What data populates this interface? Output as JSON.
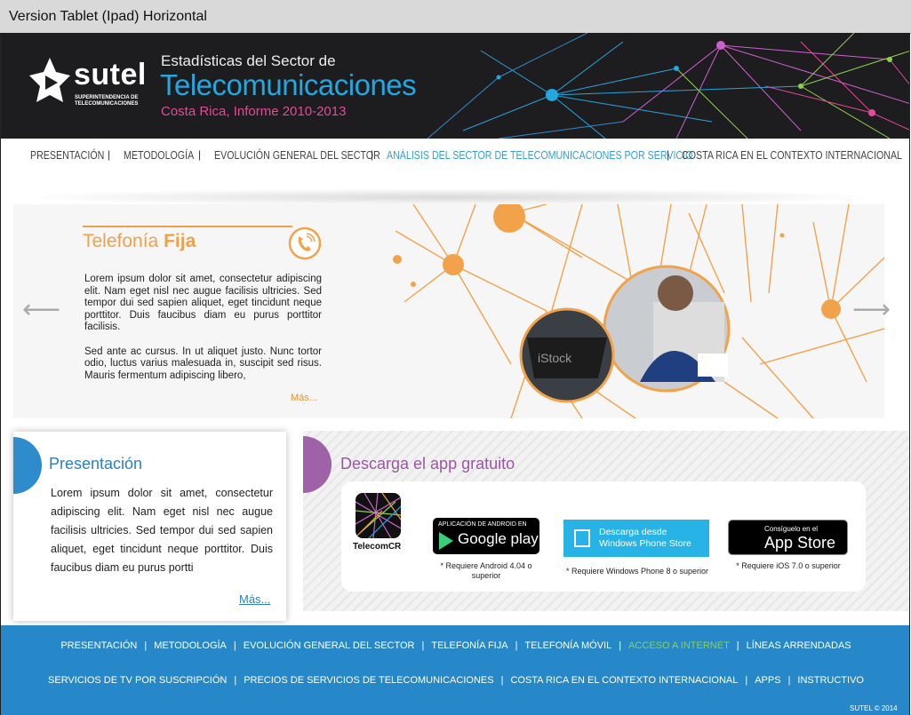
{
  "caption": "Version Tablet (Ipad) Horizontal",
  "header": {
    "logo_word": "sutel",
    "logo_sub_1": "SUPERINTENDENCIA DE",
    "logo_sub_2": "TELECOMUNICACIONES",
    "line1": "Estadísticas del Sector de",
    "line2": "Telecomunicaciones",
    "line3": "Costa Rica, Informe 2010-2013"
  },
  "nav": {
    "items": [
      {
        "label": "PRESENTACIÓN"
      },
      {
        "label": "METODOLOGÍA"
      },
      {
        "label": "EVOLUCIÓN GENERAL DEL SECTOR"
      },
      {
        "label": "ANÁLISIS DEL SECTOR DE TELECOMUNICACIONES POR SERVICIO",
        "active": true
      },
      {
        "label": "COSTA RICA EN EL CONTEXTO INTERNACIONAL"
      }
    ],
    "separator": "|"
  },
  "slider": {
    "title_light": "Telefonía ",
    "title_bold": "Fija",
    "paragraph1": "Lorem ipsum dolor sit amet, consectetur adipiscing elit. Nam eget nisl nec augue facilisis ultricies. Sed tempor dui sed sapien aliquet, eget tincidunt neque porttitor. Duis faucibus diam eu purus porttitor facilisis.",
    "paragraph2": "Sed ante ac cursus. In ut aliquet justo. Nunc tortor odio, luctus varius malesuada in, suscipit sed risus. Mauris fermentum adipiscing libero,",
    "more": "Más...",
    "prev_arrow": "⟵",
    "next_arrow": "⟶",
    "photo_watermark": "iStock"
  },
  "presentacion": {
    "title": "Presentación",
    "text": "Lorem ipsum dolor sit amet, consectetur adipiscing elit. Nam eget nisl nec augue facilisis ultricies. Sed tempor dui sed sapien aliquet, eget tincidunt neque porttitor. Duis faucibus diam eu purus portti",
    "more": "Más..."
  },
  "app": {
    "title": "Descarga el app gratuito",
    "app_name": "TelecomCR",
    "google_small": "APLICACIÓN DE ANDROID EN",
    "google_big": "Google play",
    "google_note": "* Requiere Android 4.04 o superior",
    "windows_line1": "Descarga desde",
    "windows_line2": "Windows Phone Store",
    "windows_note": "* Requiere Windows Phone 8 o superior",
    "apple_small": "Consíguelo en el",
    "apple_big": "App Store",
    "apple_icon": "",
    "apple_note": "* Requiere iOS 7.0 o superior"
  },
  "footer": {
    "row1": [
      {
        "label": "PRESENTACIÓN"
      },
      {
        "label": "METODOLOGÍA"
      },
      {
        "label": "EVOLUCIÓN GENERAL DEL SECTOR"
      },
      {
        "label": "TELEFONÍA FIJA"
      },
      {
        "label": "TELEFONÍA MÓVIL"
      },
      {
        "label": "ACCESO A INTERNET",
        "highlight": true
      },
      {
        "label": "LÍNEAS ARRENDADAS"
      }
    ],
    "row2": [
      {
        "label": "SERVICIOS DE TV POR SUSCRIPCIÓN"
      },
      {
        "label": "PRECIOS DE SERVICIOS DE TELECOMUNICACIONES"
      },
      {
        "label": "COSTA RICA EN EL CONTEXTO INTERNACIONAL"
      },
      {
        "label": "APPS"
      },
      {
        "label": "INSTRUCTIVO"
      }
    ],
    "separator": "|",
    "copyright": "SUTEL ©  2014"
  },
  "colors": {
    "header_bg": "#1d1d1f",
    "accent_blue": "#23a7df",
    "accent_pink": "#e34a9a",
    "accent_orange": "#f0a048",
    "nav_active": "#3a9bd1",
    "footer_bg": "#2688c8",
    "footer_highlight": "#8dd14a",
    "app_purple": "#9a57a4"
  }
}
